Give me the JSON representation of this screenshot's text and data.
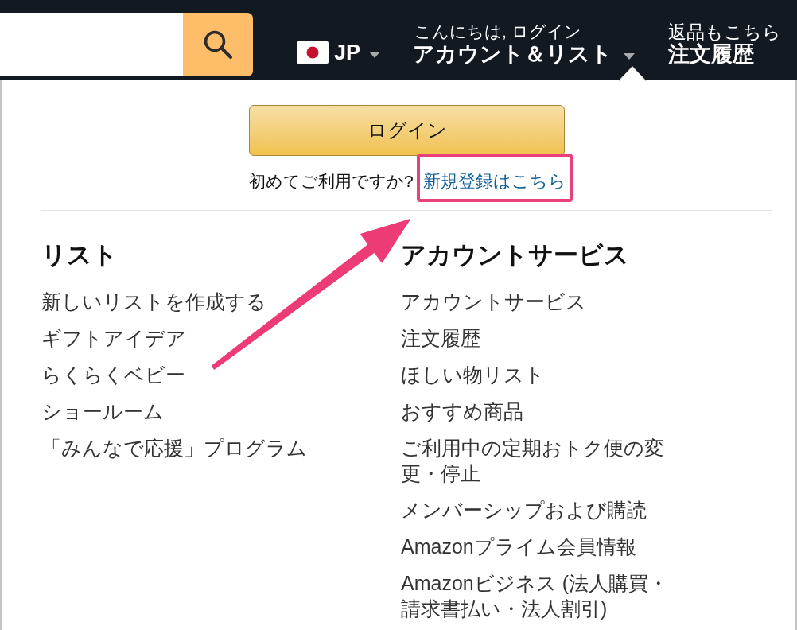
{
  "header": {
    "locale": {
      "code": "JP"
    },
    "account": {
      "greeting": "こんにちは, ログイン",
      "label": "アカウント＆リスト"
    },
    "orders": {
      "greeting": "返品もこちら",
      "label": "注文履歴"
    }
  },
  "menu": {
    "login_button": "ログイン",
    "signup_prompt": "初めてご利用ですか?",
    "signup_link": "新規登録はこちら",
    "columns": [
      {
        "heading": "リスト",
        "items": [
          "新しいリストを作成する",
          "ギフトアイデア",
          "らくらくベビー",
          "ショールーム",
          "「みんなで応援」プログラム"
        ]
      },
      {
        "heading": "アカウントサービス",
        "items": [
          "アカウントサービス",
          "注文履歴",
          "ほしい物リスト",
          "おすすめ商品",
          "ご利用中の定期おトク便の変更・停止",
          "メンバーシップおよび購読",
          "Amazonプライム会員情報",
          "Amazonビジネス (法人購買・請求書払い・法人割引)"
        ]
      }
    ]
  }
}
